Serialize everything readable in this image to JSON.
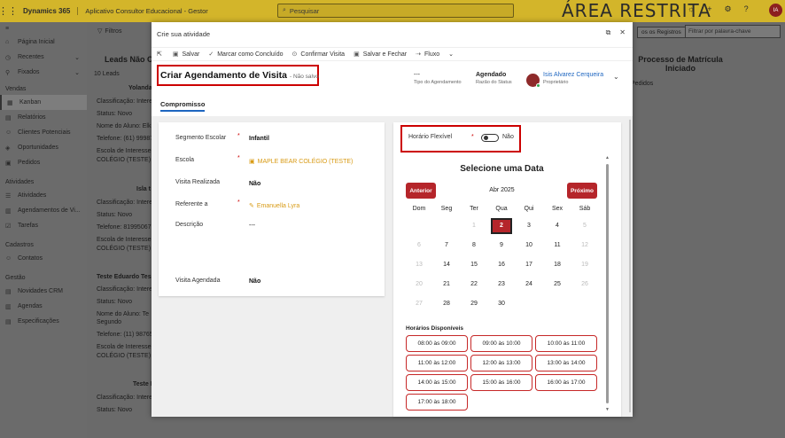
{
  "topbar": {
    "brand": "Dynamics 365",
    "app_name": "Aplicativo Consultor Educacional - Gestor",
    "search_placeholder": "Pesquisar",
    "banner": "ÁREA RESTRITA",
    "avatar_initials": "IA"
  },
  "leftnav": {
    "items_top": [
      {
        "label": "Página Inicial",
        "icon": "home-icon"
      },
      {
        "label": "Recentes",
        "icon": "clock-icon"
      },
      {
        "label": "Fixados",
        "icon": "pin-icon"
      }
    ],
    "sections": [
      {
        "title": "Vendas",
        "items": [
          "Kanban",
          "Relatórios",
          "Clientes Potenciais",
          "Oportunidades",
          "Pedidos"
        ]
      },
      {
        "title": "Atividades",
        "items": [
          "Atividades",
          "Agendamentos de Vi...",
          "Tarefas"
        ]
      },
      {
        "title": "Cadastros",
        "items": [
          "Contatos"
        ]
      },
      {
        "title": "Gestão",
        "items": [
          "Novidades CRM",
          "Agendas",
          "Especificações"
        ]
      }
    ]
  },
  "board": {
    "filters_label": "Filtros",
    "col_leads": "Leads Não C",
    "leads_count": "10 Leads",
    "col_matricula": "Processo de Matrícula Iniciado",
    "pedidos": "Pedidos",
    "all_records": "os os Registros",
    "filter_placeholder": "Filtrar por palavra-chave",
    "cards": [
      [
        "Yolanda",
        "Classificação: Intere",
        "Status: Novo",
        "Nome do Aluno: Elk",
        "Telefone: (61) 99987",
        "Escola de Interesse:",
        "COLÉGIO (TESTE)"
      ],
      [
        "Isla t",
        "Classificação: Intere",
        "Status: Novo",
        "Telefone: 81995067",
        "Escola de Interesse:",
        "COLÉGIO (TESTE)"
      ],
      [
        "Teste Eduardo Tes",
        "Classificação: Intere",
        "Status: Novo",
        "Nome do Aluno: Te",
        "Segundo",
        "Telefone: (11) 98765",
        "Escola de Interesse:",
        "COLÉGIO (TESTE)"
      ],
      [
        "Teste I",
        "Classificação: Intere",
        "Status: Novo"
      ]
    ]
  },
  "modal": {
    "title": "Crie sua atividade",
    "toolbar": {
      "save": "Salvar",
      "save_done": "Marcar como Concluído",
      "confirm": "Confirmar Visita",
      "save_close": "Salvar e Fechar",
      "flow": "Fluxo"
    },
    "header": {
      "title": "Criar Agendamento de Visita",
      "unsaved": "- Não salvo",
      "type_value": "---",
      "type_label": "Tipo do Agendamento",
      "status_value": "Agendado",
      "status_label": "Razão do Status",
      "owner_name": "Isis Alvarez Cerqueira",
      "owner_label": "Proprietário"
    },
    "tab": "Compromisso",
    "form": {
      "segment_label": "Segmento Escolar",
      "segment_value": "Infantil",
      "school_label": "Escola",
      "school_value": "MAPLE BEAR COLÉGIO (TESTE)",
      "visit_done_label": "Visita Realizada",
      "visit_done_value": "Não",
      "referring_label": "Referente a",
      "referring_value": "Emanuella Lyra",
      "desc_label": "Descrição",
      "desc_value": "---",
      "visit_sched_label": "Visita Agendada",
      "visit_sched_value": "Não",
      "required_mark": "*"
    },
    "flexible": {
      "label": "Horário Flexível",
      "value": "Não"
    },
    "calendar": {
      "title": "Selecione uma Data",
      "prev": "Anterior",
      "next": "Próximo",
      "month": "Abr 2025",
      "weekdays": [
        "Dom",
        "Seg",
        "Ter",
        "Qua",
        "Qui",
        "Sex",
        "Sáb"
      ],
      "weeks": [
        [
          {
            "d": "",
            "m": true
          },
          {
            "d": "",
            "m": true
          },
          {
            "d": "1",
            "m": true
          },
          {
            "d": "2",
            "sel": true
          },
          {
            "d": "3"
          },
          {
            "d": "4"
          },
          {
            "d": "5",
            "m": true
          }
        ],
        [
          {
            "d": "6",
            "m": true
          },
          {
            "d": "7"
          },
          {
            "d": "8"
          },
          {
            "d": "9"
          },
          {
            "d": "10"
          },
          {
            "d": "11"
          },
          {
            "d": "12",
            "m": true
          }
        ],
        [
          {
            "d": "13",
            "m": true
          },
          {
            "d": "14"
          },
          {
            "d": "15"
          },
          {
            "d": "16"
          },
          {
            "d": "17"
          },
          {
            "d": "18"
          },
          {
            "d": "19",
            "m": true
          }
        ],
        [
          {
            "d": "20",
            "m": true
          },
          {
            "d": "21"
          },
          {
            "d": "22"
          },
          {
            "d": "23"
          },
          {
            "d": "24"
          },
          {
            "d": "25"
          },
          {
            "d": "26",
            "m": true
          }
        ],
        [
          {
            "d": "27",
            "m": true
          },
          {
            "d": "28"
          },
          {
            "d": "29"
          },
          {
            "d": "30"
          },
          {
            "d": "",
            "m": true
          },
          {
            "d": "",
            "m": true
          },
          {
            "d": "",
            "m": true
          }
        ]
      ],
      "slots_title": "Horários Disponíveis",
      "slots": [
        "08:00 às 09:00",
        "09:00 às 10:00",
        "10:00 às 11:00",
        "11:00 às 12:00",
        "12:00 às 13:00",
        "13:00 às 14:00",
        "14:00 às 15:00",
        "15:00 às 16:00",
        "16:00 às 17:00",
        "17:00 às 18:00"
      ]
    }
  },
  "colors": {
    "topbar": "#d3b52a",
    "accent_red": "#b5252a",
    "link_blue": "#1e66c0",
    "school_orange": "#d89a14"
  }
}
